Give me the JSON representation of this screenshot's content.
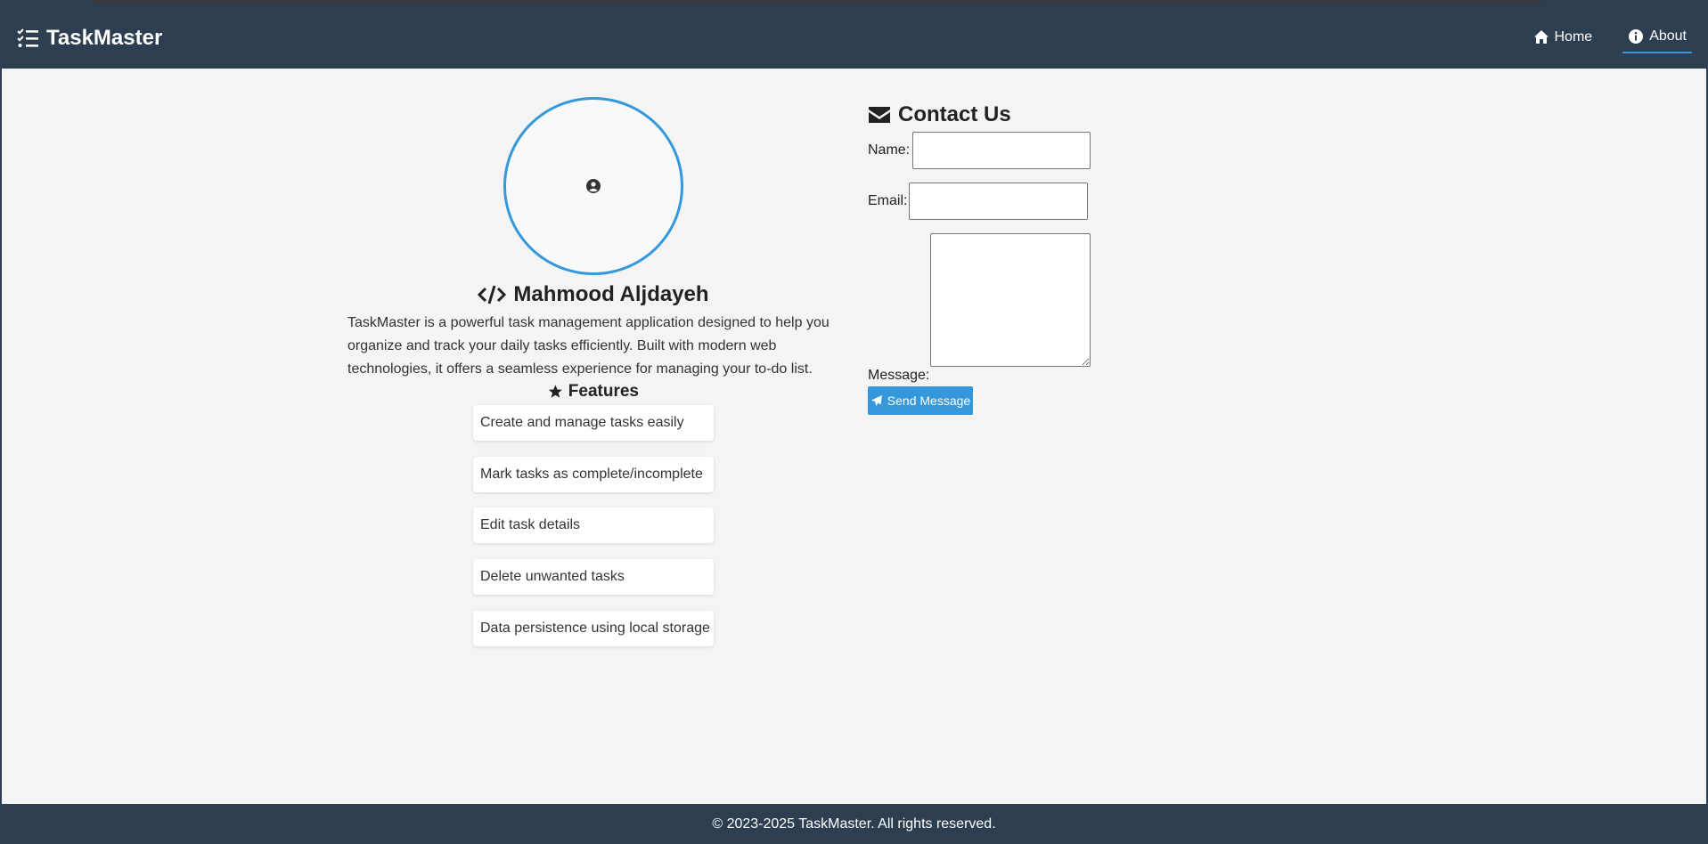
{
  "app": {
    "title": "TaskMaster"
  },
  "nav": {
    "items": [
      {
        "label": "Home",
        "icon": "home-icon",
        "active": false
      },
      {
        "label": "About",
        "icon": "info-icon",
        "active": true
      }
    ]
  },
  "profile": {
    "name": "Mahmood Aljdayeh",
    "description": "TaskMaster is a powerful task management application designed to help you organize and track your daily tasks efficiently. Built with modern web technologies, it offers a seamless experience for managing your to-do list."
  },
  "features": {
    "title": "Features",
    "items": [
      "Create and manage tasks easily",
      "Mark tasks as complete/incomplete",
      "Edit task details",
      "Delete unwanted tasks",
      "Data persistence using local storage"
    ]
  },
  "contact": {
    "title": "Contact Us",
    "name_label": "Name:",
    "email_label": "Email:",
    "message_label": "Message:",
    "name_value": "",
    "email_value": "",
    "message_value": "",
    "send_label": "Send Message"
  },
  "footer": {
    "text": "© 2023-2025 TaskMaster. All rights reserved."
  },
  "colors": {
    "header_bg": "#2d3e50",
    "accent": "#3498db",
    "page_bg": "#f4f4f4"
  }
}
